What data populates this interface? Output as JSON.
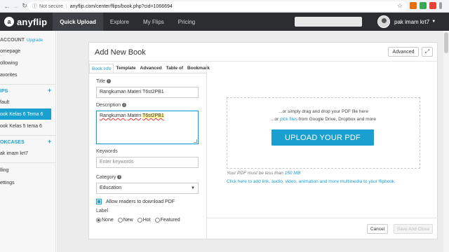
{
  "browser": {
    "security_label": "Not secure",
    "url": "anyflip.com/center/flips/book.php?cid=1066694"
  },
  "header": {
    "logo_text": "anyflip",
    "nav": [
      "Quick Upload",
      "Explore",
      "My Flips",
      "Pricing"
    ],
    "active_nav": "Quick Upload",
    "user_name": "pak imam krt7"
  },
  "sidebar": {
    "account_label": "ACCOUNT",
    "upgrade_label": "Upgrade",
    "account_items": [
      "omepage",
      "ollowing",
      "avorites"
    ],
    "flips_label": "IPS",
    "flip_items": [
      "fault",
      "ook Kelas 6 Tema 6",
      "ook Kelas 5 tema 6"
    ],
    "active_flip": "ook Kelas 6 Tema 6",
    "bookcases_label": "OKCASES",
    "bookcase_items": [
      "ak imam krt7"
    ],
    "bottom_items": [
      "lling",
      "ettings"
    ]
  },
  "modal": {
    "title": "Add New Book",
    "advanced_button": "Advanced",
    "expand_icon": "expand-icon",
    "tabs": [
      "Book Info",
      "Template",
      "Advanced",
      "Table of",
      "Bookmark"
    ],
    "active_tab": "Book Info",
    "fields": {
      "title_label": "Title",
      "title_value": "Rangkuman Materi T6st2PB1",
      "description_label": "Description",
      "description_value": {
        "part1": "Rangkuman",
        "part2": " ",
        "part3": "Materi",
        "part4": " ",
        "part5": "T6st2PB1"
      },
      "keywords_label": "Keywords",
      "keywords_placeholder": "Enter keywords",
      "category_label": "Category",
      "category_value": "Education",
      "allow_download_label": "Allow readers to download PDF",
      "allow_download_checked": true,
      "label_label": "Label",
      "label_options": [
        "None",
        "New",
        "Hot",
        "Featured"
      ],
      "label_selected": "None"
    },
    "upload": {
      "drag_text": "...or simply drag and drop your PDF file here",
      "or_text": "...or ",
      "pick_files_link": "pick files",
      "from_text": " from Google Drive, Dropbox and more",
      "upload_button": "UPLOAD YOUR PDF",
      "limit_prefix": "Your PDF must be less than ",
      "limit_size": "150 MB",
      "media_link": "Click here to add link, audio, video, animation and more multimedia to your flipbook."
    },
    "footer": {
      "cancel_button": "Cancel",
      "save_button": "Save And Close"
    }
  },
  "colors": {
    "accent": "#1a9fd1",
    "header_bg": "#2b2d31"
  }
}
